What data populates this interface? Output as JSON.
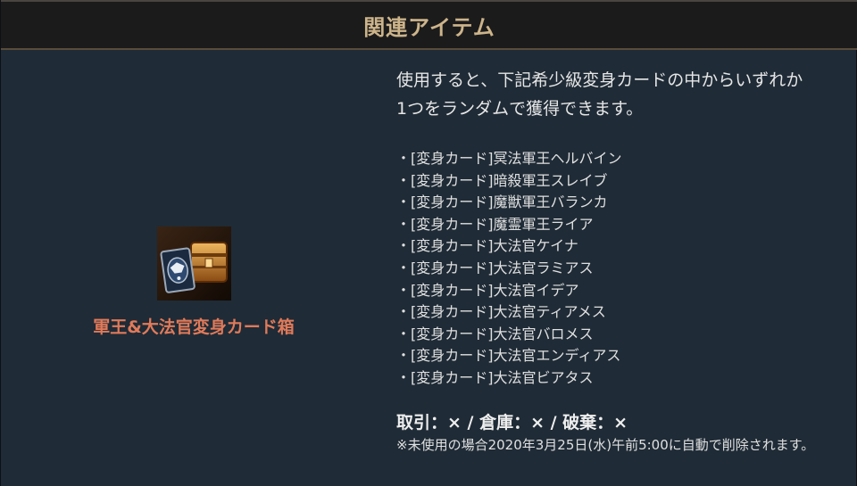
{
  "header": {
    "title": "関連アイテム"
  },
  "item": {
    "name": "軍王&大法官変身カード箱",
    "icon": "card-box-icon"
  },
  "description": {
    "line1": "使用すると、下記希少級変身カードの中からいずれか",
    "line2": "1つをランダムで獲得できます。"
  },
  "cards": [
    "・[変身カード]冥法軍王ヘルバイン",
    "・[変身カード]暗殺軍王スレイブ",
    "・[変身カード]魔獣軍王バランカ",
    "・[変身カード]魔霊軍王ライア",
    "・[変身カード]大法官ケイナ",
    "・[変身カード]大法官ラミアス",
    "・[変身カード]大法官イデア",
    "・[変身カード]大法官ティアメス",
    "・[変身カード]大法官バロメス",
    "・[変身カード]大法官エンディアス",
    "・[変身カード]大法官ビアタス"
  ],
  "trade": "取引：× / 倉庫：× / 破棄：×",
  "note": "※未使用の場合2020年3月25日(水)午前5:00に自動で削除されます。",
  "colors": {
    "accent": "#cdb48a",
    "item_name": "#e07a5a",
    "background": "#1f2b36"
  }
}
